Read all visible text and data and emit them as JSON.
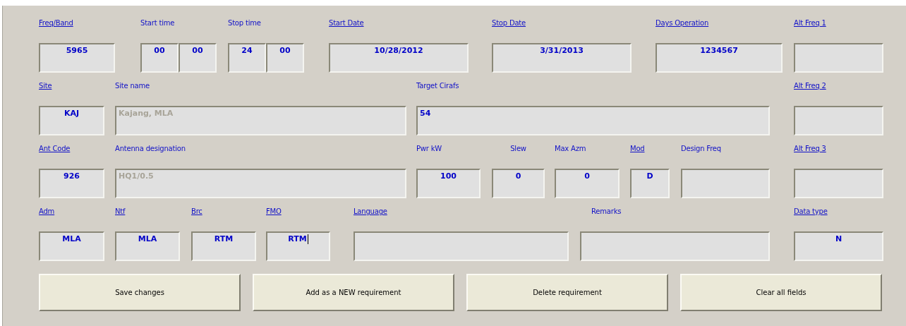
{
  "rows": [
    {
      "fields": [
        {
          "label": "Freq/Band",
          "link": true,
          "value": "5965",
          "kind": "code",
          "focused": false
        },
        {
          "label": "Start time",
          "link": false,
          "values": [
            "00",
            "00"
          ],
          "kind": "code",
          "focused": false
        },
        {
          "label": "Stop time",
          "link": false,
          "values": [
            "24",
            "00"
          ],
          "kind": "code",
          "focused": false
        },
        {
          "label": "Start Date",
          "link": true,
          "value": "10/28/2012",
          "kind": "code",
          "focused": false
        },
        {
          "label": "Stop Date",
          "link": true,
          "value": "3/31/2013",
          "kind": "code",
          "focused": false
        },
        {
          "label": "Days Operation",
          "link": true,
          "value": "1234567",
          "kind": "code",
          "focused": false
        },
        {
          "label": "Alt Freq 1",
          "link": true,
          "kind": "code",
          "focused": false
        }
      ]
    },
    {
      "fields": [
        {
          "label": "Site",
          "link": true,
          "value": "KAJ",
          "kind": "code",
          "focused": false
        },
        {
          "label": "Site name",
          "link": false,
          "value": "Kajang, MLA",
          "kind": "readonly",
          "focused": false
        },
        {
          "label": "Target Cirafs",
          "link": false,
          "value": "54",
          "kind": "text",
          "focused": false
        },
        {
          "label": "Alt Freq 2",
          "link": true,
          "kind": "code",
          "focused": false
        }
      ]
    },
    {
      "fields": [
        {
          "label": "Ant Code",
          "link": true,
          "value": "926",
          "kind": "code",
          "focused": false
        },
        {
          "label": "Antenna designation",
          "link": false,
          "value": "HQ1/0.5",
          "kind": "readonly",
          "focused": false
        },
        {
          "label": "Pwr kW",
          "link": false,
          "value": "100",
          "kind": "code",
          "focused": false
        },
        {
          "label": "Slew",
          "link": false,
          "value": "0",
          "kind": "code",
          "focused": false
        },
        {
          "label": "Max Azm",
          "link": false,
          "value": "0",
          "kind": "code",
          "focused": false
        },
        {
          "label": "Mod",
          "link": true,
          "value": "D",
          "kind": "code",
          "focused": false
        },
        {
          "label": "Design Freq",
          "link": false,
          "kind": "code",
          "focused": false
        },
        {
          "label": "Alt Freq 3",
          "link": true,
          "kind": "code",
          "focused": false
        }
      ]
    },
    {
      "fields": [
        {
          "label": "Adm",
          "link": true,
          "value": "MLA",
          "kind": "code",
          "focused": false
        },
        {
          "label": "Ntf",
          "link": true,
          "value": "MLA",
          "kind": "code",
          "focused": false
        },
        {
          "label": "Brc",
          "link": true,
          "value": "RTM",
          "kind": "code",
          "focused": false
        },
        {
          "label": "FMO",
          "link": true,
          "value": "RTM",
          "kind": "code",
          "focused": true
        },
        {
          "label": "Language",
          "link": true,
          "kind": "code",
          "focused": false
        },
        {
          "label": "Remarks",
          "link": false,
          "kind": "code",
          "focused": false
        },
        {
          "label": "Data type",
          "link": true,
          "value": "N",
          "kind": "code",
          "focused": false
        }
      ]
    }
  ],
  "buttons": [
    "Save changes",
    "Add as a NEW requirement",
    "Delete requirement",
    "Clear all fields"
  ]
}
